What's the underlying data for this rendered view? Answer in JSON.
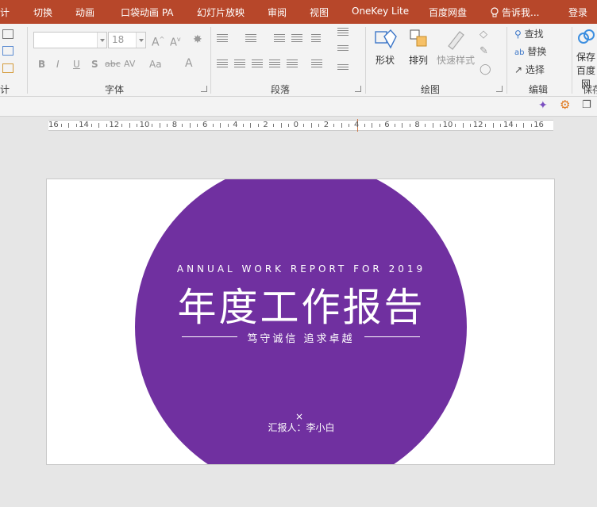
{
  "menubar": {
    "tabs": [
      "计",
      "切换",
      "动画",
      "口袋动画 PA",
      "幻灯片放映",
      "审阅",
      "视图",
      "OneKey Lite",
      "百度网盘"
    ],
    "tell_me": "告诉我...",
    "login": "登录"
  },
  "ribbon": {
    "font": {
      "label": "字体",
      "size": "18",
      "buttons": [
        "B",
        "I",
        "U",
        "S",
        "abc",
        "AV",
        "Aa",
        "A"
      ]
    },
    "paragraph": {
      "label": "段落"
    },
    "drawing": {
      "label": "绘图",
      "shapes": "形状",
      "arrange": "排列",
      "quick_styles": "快速样式"
    },
    "editing": {
      "label": "编辑",
      "find": "查找",
      "replace": "替换",
      "select": "选择"
    },
    "save": {
      "label": "保存",
      "btn_line1": "保存",
      "btn_line2": "百度网"
    },
    "left_label": "计"
  },
  "ruler": {
    "labels": [
      "16",
      "14",
      "12",
      "10",
      "8",
      "6",
      "4",
      "2",
      "0",
      "2",
      "4",
      "6",
      "8",
      "10",
      "12",
      "14",
      "16"
    ]
  },
  "slide": {
    "subtitle_en": "ANNUAL WORK REPORT FOR 2019",
    "title": "年度工作报告",
    "slogan": "笃守诚信 追求卓越",
    "close_glyph": "×",
    "reporter": "汇报人：李小白"
  },
  "colors": {
    "menubar": "#b7472a",
    "circle": "#7030a0",
    "ribbon": "#f3f3f3"
  }
}
